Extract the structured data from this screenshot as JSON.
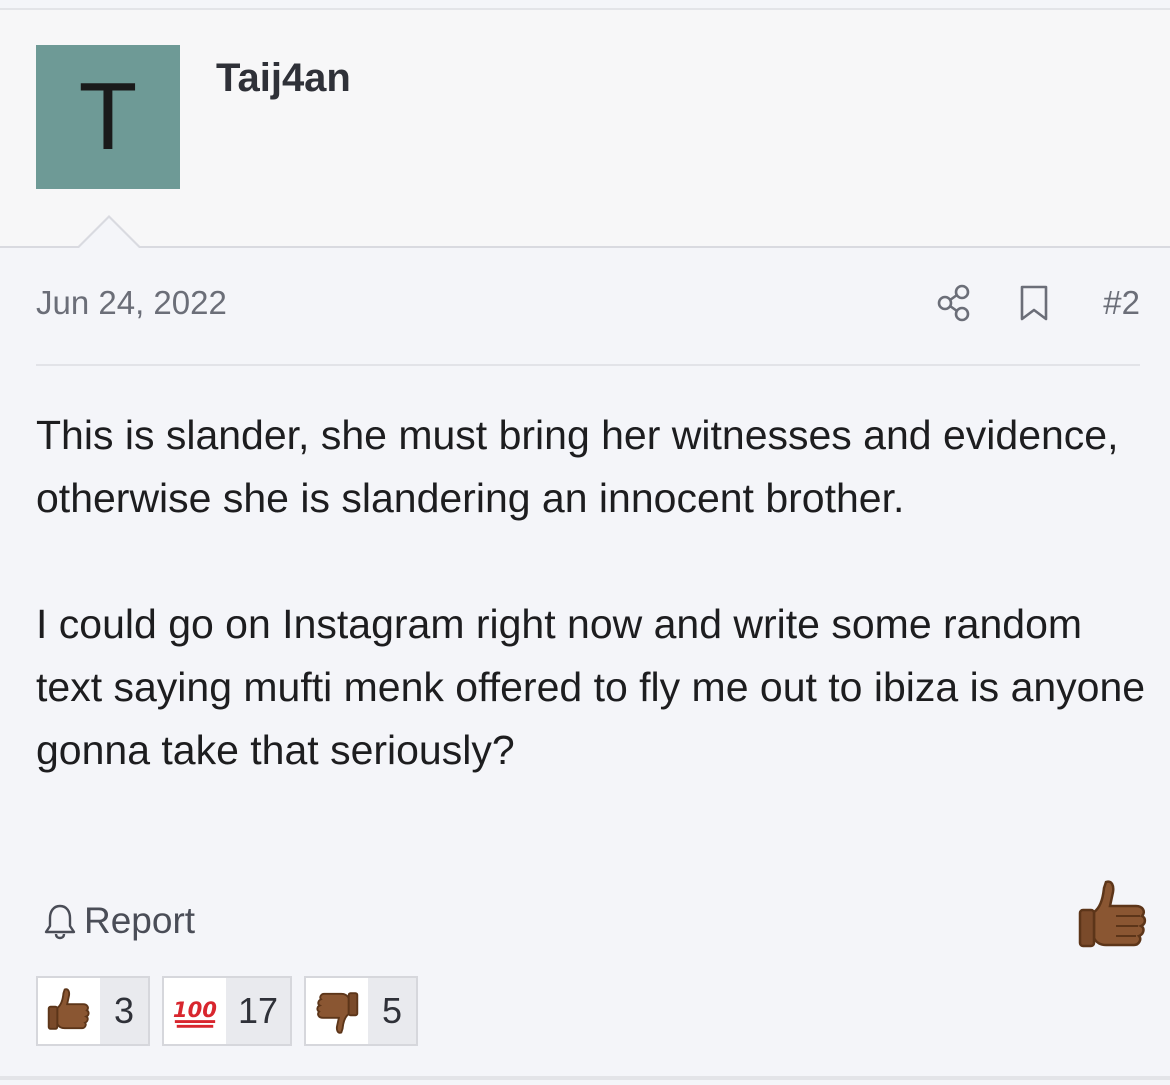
{
  "post": {
    "author": {
      "initial": "T",
      "username": "Taij4an",
      "avatar_color": "#6e9a96"
    },
    "date": "Jun 24, 2022",
    "post_number": "#2",
    "body": [
      "This is slander, she must bring her witnesses and evidence, otherwise she is slandering an innocent brother.",
      "I could go on Instagram right now and write some random text saying mufti menk offered to fly me out to ibiza is anyone gonna take that seriously?"
    ],
    "actions": {
      "report_label": "Report",
      "share_icon": "share-icon",
      "bookmark_icon": "bookmark-icon",
      "like_icon": "thumbs-up-icon"
    },
    "reactions": [
      {
        "icon": "thumbs-up-icon",
        "count": "3"
      },
      {
        "icon": "hundred-points-icon",
        "count": "17"
      },
      {
        "icon": "thumbs-down-icon",
        "count": "5"
      }
    ]
  }
}
